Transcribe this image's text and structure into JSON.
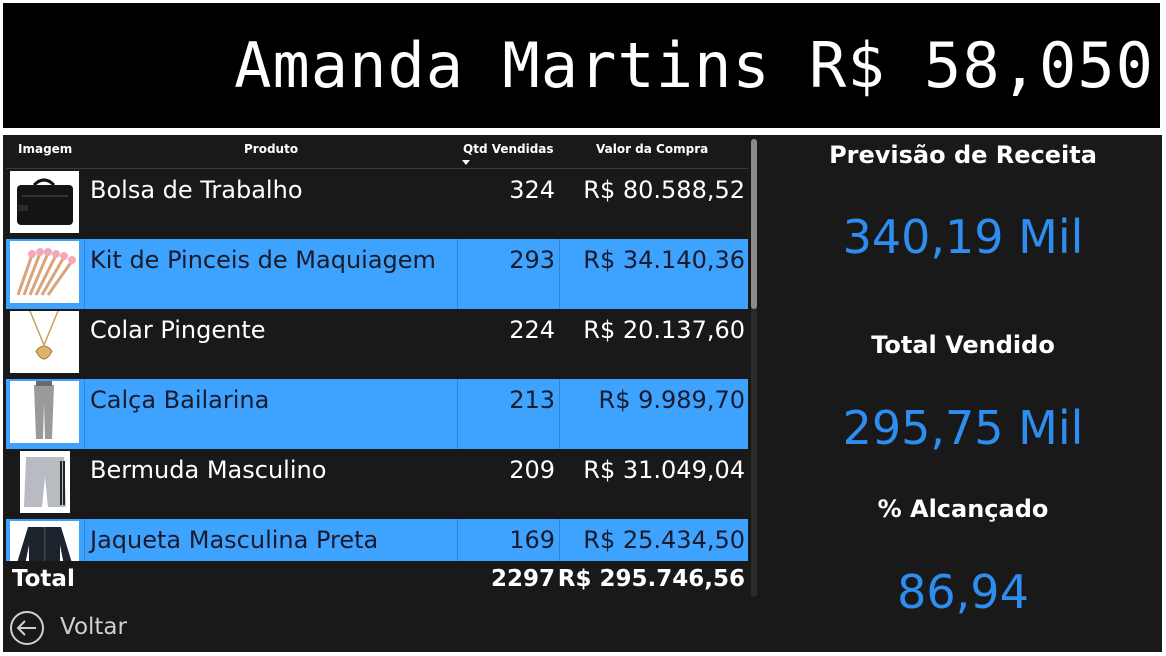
{
  "header": {
    "title": "Amanda Martins R$ 58,050"
  },
  "table": {
    "columns": [
      "Imagem",
      "Produto",
      "Qtd Vendidas",
      "Valor da Compra"
    ],
    "sorted_column": "Qtd Vendidas",
    "rows": [
      {
        "image_icon": "black-laptop-bag-image",
        "product": "Bolsa de Trabalho",
        "qty": "324",
        "value": "R$ 80.588,52"
      },
      {
        "image_icon": "makeup-brushes-image",
        "product": "Kit de Pinceis de Maquiagem",
        "qty": "293",
        "value": "R$ 34.140,36"
      },
      {
        "image_icon": "shell-necklace-image",
        "product": "Colar Pingente",
        "qty": "224",
        "value": "R$ 20.137,60"
      },
      {
        "image_icon": "grey-leggings-image",
        "product": "Calça Bailarina",
        "qty": "213",
        "value": "R$ 9.989,70"
      },
      {
        "image_icon": "grey-shorts-image",
        "product": "Bermuda Masculino",
        "qty": "209",
        "value": "R$ 31.049,04"
      },
      {
        "image_icon": "black-jacket-image",
        "product": "Jaqueta Masculina Preta",
        "qty": "169",
        "value": "R$ 25.434,50"
      }
    ],
    "total": {
      "label": "Total",
      "qty": "2297",
      "value": "R$ 295.746,56"
    }
  },
  "back_button": {
    "label": "Voltar",
    "icon": "arrow-left-circle-icon"
  },
  "kpis": [
    {
      "title": "Previsão de Receita",
      "value": "340,19 Mil"
    },
    {
      "title": "Total Vendido",
      "value": "295,75 Mil"
    },
    {
      "title": "% Alcançado",
      "value": "86,94"
    }
  ],
  "colors": {
    "accent": "#3ea2ff",
    "kpi_value": "#2e8df0",
    "background": "#191919"
  }
}
